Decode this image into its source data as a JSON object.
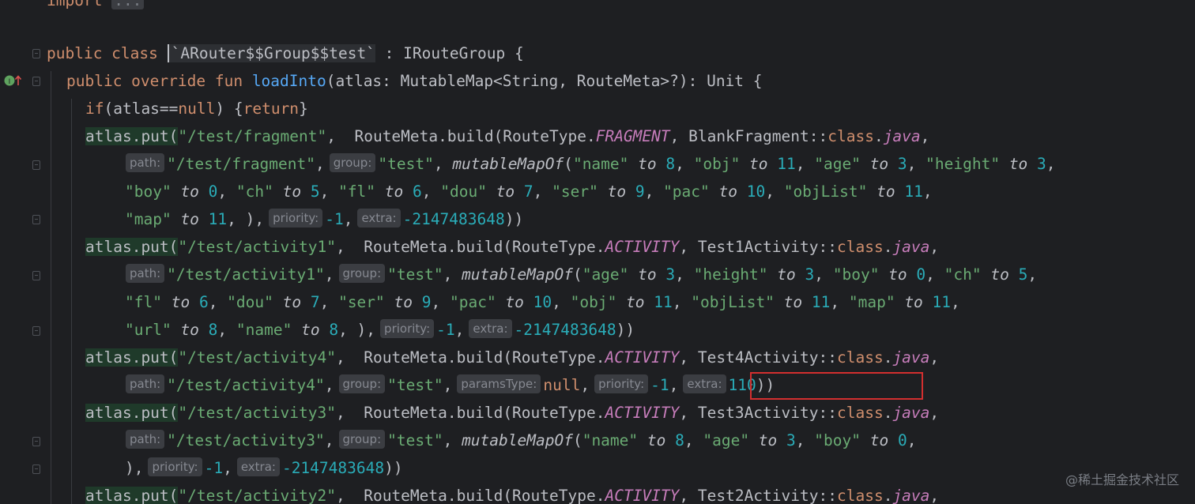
{
  "watermark": "@稀土掘金技术社区",
  "code": {
    "l0": {
      "import_kw": "import",
      "import_dots": "..."
    },
    "l1": {
      "kw1": "public class",
      "class_name": "`ARouter$$Group$$test`",
      "rest": " : IRouteGroup {"
    },
    "l2": {
      "kw1": "public override fun",
      "fn": "loadInto",
      "rest": "(atlas: MutableMap<String, RouteMeta>?): Unit {"
    },
    "l3": {
      "if": "if",
      "p1": "(atlas==",
      "null": "null",
      "p2": ") {",
      "return": "return",
      "p3": "}"
    },
    "l4": {
      "a": "atlas.put(",
      "s1": "\"/test/fragment\"",
      "b": ",  RouteMeta.build(RouteType.",
      "c": "FRAGMENT",
      "d": ", BlankFragment::",
      "e": "class",
      "f": ".",
      "g": "java",
      "h": ","
    },
    "l5": {
      "h1": "path:",
      "s1": "\"/test/fragment\"",
      "c1": ",",
      "h2": "group:",
      "s2": "\"test\"",
      "c2": ", ",
      "ext": "mutableMapOf",
      "p1": "(",
      "s3": "\"name\"",
      "t1": " to ",
      "n1": "8",
      "c3": ", ",
      "s4": "\"obj\"",
      "n2": "11",
      "s5": "\"age\"",
      "n3": "3",
      "s6": "\"height\"",
      "n4": "3",
      "c4": ","
    },
    "l6": {
      "s1": "\"boy\"",
      "n1": "0",
      "s2": "\"ch\"",
      "n2": "5",
      "s3": "\"fl\"",
      "n3": "6",
      "s4": "\"dou\"",
      "n4": "7",
      "s5": "\"ser\"",
      "n5": "9",
      "s6": "\"pac\"",
      "n6": "10",
      "s7": "\"objList\"",
      "n7": "11",
      "c": ",",
      "to": " to "
    },
    "l7": {
      "s1": "\"map\"",
      "n1": "11",
      "a": ", ),",
      "h1": "priority:",
      "n2": "-1",
      "c": ",",
      "h2": "extra:",
      "n3": "-2147483648",
      "e": "))"
    },
    "l8": {
      "a": "atlas.put(",
      "s1": "\"/test/activity1\"",
      "b": ",  RouteMeta.build(RouteType.",
      "c": "ACTIVITY",
      "d": ", Test1Activity::",
      "e": "class",
      "f": ".",
      "g": "java",
      "h": ","
    },
    "l9": {
      "h1": "path:",
      "s1": "\"/test/activity1\"",
      "c1": ",",
      "h2": "group:",
      "s2": "\"test\"",
      "c2": ", ",
      "ext": "mutableMapOf",
      "p1": "(",
      "s3": "\"age\"",
      "n1": "3",
      "s4": "\"height\"",
      "n2": "3",
      "s5": "\"boy\"",
      "n3": "0",
      "s6": "\"ch\"",
      "n4": "5",
      "c": ","
    },
    "l10": {
      "s1": "\"fl\"",
      "n1": "6",
      "s2": "\"dou\"",
      "n2": "7",
      "s3": "\"ser\"",
      "n3": "9",
      "s4": "\"pac\"",
      "n4": "10",
      "s5": "\"obj\"",
      "n5": "11",
      "s6": "\"objList\"",
      "n6": "11",
      "s7": "\"map\"",
      "n7": "11",
      "c": ","
    },
    "l11": {
      "s1": "\"url\"",
      "n1": "8",
      "s2": "\"name\"",
      "n2": "8",
      "a": ", ),",
      "h1": "priority:",
      "n3": "-1",
      "c": ",",
      "h2": "extra:",
      "n4": "-2147483648",
      "e": "))"
    },
    "l12": {
      "a": "atlas.put(",
      "s1": "\"/test/activity4\"",
      "b": ",  RouteMeta.build(RouteType.",
      "c": "ACTIVITY",
      "d": ", Test4Activity::",
      "e": "class",
      "f": ".",
      "g": "java",
      "h": ","
    },
    "l13": {
      "h1": "path:",
      "s1": "\"/test/activity4\"",
      "c1": ",",
      "h2": "group:",
      "s2": "\"test\"",
      "c2": ",",
      "h3": "paramsType:",
      "null": "null",
      "c3": ",",
      "h4": "priority:",
      "n1": "-1",
      "c4": ",",
      "h5": "extra:",
      "n2": "110",
      "e": "))"
    },
    "l14": {
      "a": "atlas.put(",
      "s1": "\"/test/activity3\"",
      "b": ",  RouteMeta.build(RouteType.",
      "c": "ACTIVITY",
      "d": ", Test3Activity::",
      "e": "class",
      "f": ".",
      "g": "java",
      "h": ","
    },
    "l15": {
      "h1": "path:",
      "s1": "\"/test/activity3\"",
      "c1": ",",
      "h2": "group:",
      "s2": "\"test\"",
      "c2": ", ",
      "ext": "mutableMapOf",
      "p1": "(",
      "s3": "\"name\"",
      "n1": "8",
      "s4": "\"age\"",
      "n2": "3",
      "s5": "\"boy\"",
      "n3": "0",
      "c": ","
    },
    "l16": {
      "a": "),",
      "h1": "priority:",
      "n1": "-1",
      "c": ",",
      "h2": "extra:",
      "n2": "-2147483648",
      "e": "))"
    },
    "l17": {
      "a": "atlas.put(",
      "s1": "\"/test/activity2\"",
      "b": ",  RouteMeta.build(RouteType.",
      "c": "ACTIVITY",
      "d": ", Test2Activity::",
      "e": "class",
      "f": ".",
      "g": "java",
      "h": ","
    }
  }
}
